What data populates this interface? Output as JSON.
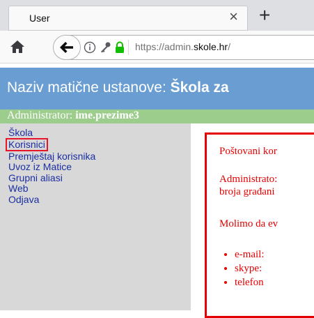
{
  "browser": {
    "tab_title": "User",
    "close_symbol": "×",
    "new_tab_symbol": "+",
    "url_prefix": "https://admin.",
    "url_domain": "skole.hr",
    "url_suffix": "/",
    "icons": [
      "home-icon",
      "back-arrow-icon",
      "info-icon",
      "key-icon",
      "lock-icon"
    ]
  },
  "header": {
    "label": "Naziv matične ustanove: ",
    "school": "Škola za"
  },
  "admin_bar": {
    "label": "Administrator: ",
    "username": "ime.prezime3"
  },
  "sidebar": {
    "items": [
      {
        "label": "Škola"
      },
      {
        "label": "Korisnici",
        "active": true
      },
      {
        "label": "Premještaj korisnika"
      },
      {
        "label": "Uvoz iz Matice"
      },
      {
        "label": "Grupni aliasi"
      },
      {
        "label": "Web"
      },
      {
        "label": "Odjava"
      }
    ]
  },
  "notice": {
    "line1": "Poštovani kor",
    "line2": "Administrato:",
    "line3": "broja građani",
    "line4": "Molimo da ev",
    "items": [
      "e-mail:",
      "skype:",
      "telefon"
    ]
  },
  "colors": {
    "header_bg": "#6a9ed2",
    "admin_bar_bg": "#9ccd8c",
    "sidebar_bg": "#d8d8d8",
    "link": "#1a2ea3",
    "notice_red": "#e40000",
    "highlight_box": "#e8142a"
  }
}
